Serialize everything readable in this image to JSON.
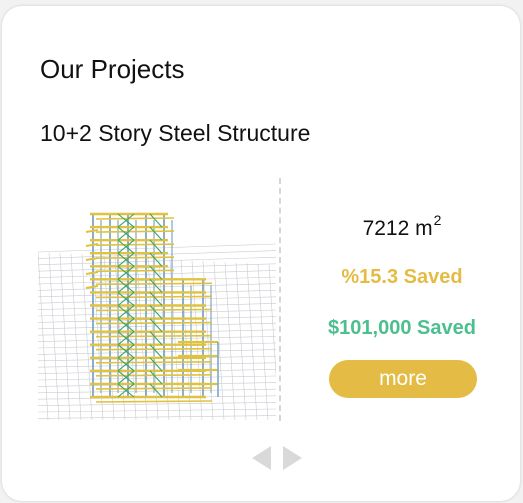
{
  "card": {
    "section_title": "Our Projects",
    "project_title": "10+2 Story Steel Structure"
  },
  "project": {
    "area_value": "7212 m",
    "area_unit_exp": "2",
    "percent_saved": "%15.3 Saved",
    "money_saved": "$101,000 Saved",
    "more_label": "more"
  },
  "render": {
    "icon": "steel-structure-render",
    "colors": {
      "beam": "#e0c23c",
      "column": "#7fa6c9",
      "brace": "#3aa26b",
      "grid": "#c9ccd1"
    }
  },
  "navigation": {
    "prev_icon": "chevron-left-icon",
    "next_icon": "chevron-right-icon",
    "arrow_color": "#d9d9d9"
  },
  "colors": {
    "accent_gold": "#e4bc45",
    "accent_green": "#4dbf8f"
  }
}
